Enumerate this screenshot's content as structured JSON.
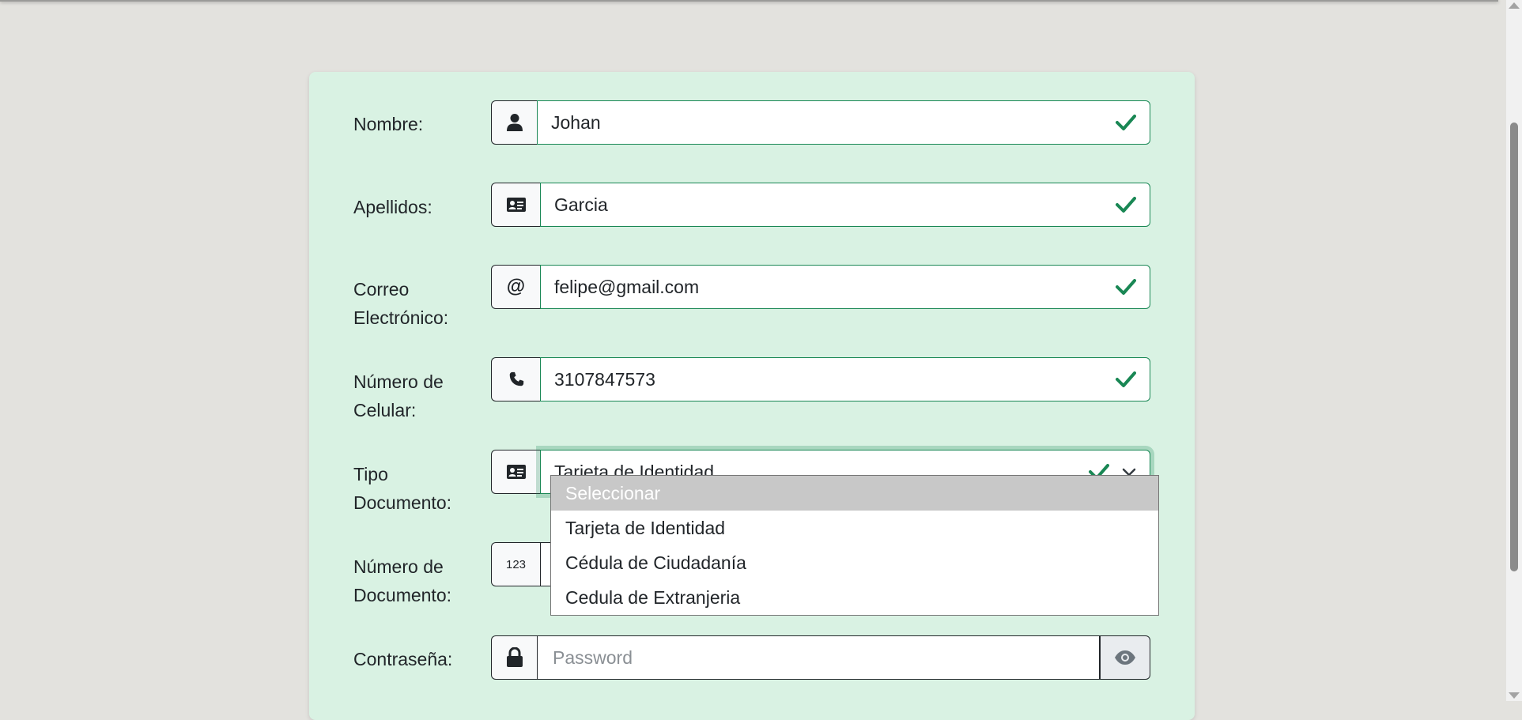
{
  "form": {
    "fields": [
      {
        "label": "Nombre:",
        "value": "Johan",
        "icon": "user-icon"
      },
      {
        "label": "Apellidos:",
        "value": "Garcia",
        "icon": "id-card-icon"
      },
      {
        "label_line1": "Correo",
        "label_line2": "Electrónico:",
        "value": "felipe@gmail.com",
        "icon": "at-icon"
      },
      {
        "label_line1": "Número de",
        "label_line2": "Celular:",
        "value": "3107847573",
        "icon": "phone-icon"
      },
      {
        "label_line1": "Tipo",
        "label_line2": "Documento:",
        "value": "Tarjeta de Identidad",
        "icon": "id-card-icon"
      },
      {
        "label_line1": "Número de",
        "label_line2": "Documento:",
        "icon_text": "123"
      },
      {
        "label": "Contraseña:",
        "placeholder": "Password",
        "icon": "lock-icon"
      }
    ],
    "document_type_options": [
      "Seleccionar",
      "Tarjeta de Identidad",
      "Cédula de Ciudadanía",
      "Cedula de Extranjeria"
    ]
  },
  "colors": {
    "card_bg": "#d9f2e3",
    "valid": "#198754",
    "page_bg": "#e3e2de"
  }
}
